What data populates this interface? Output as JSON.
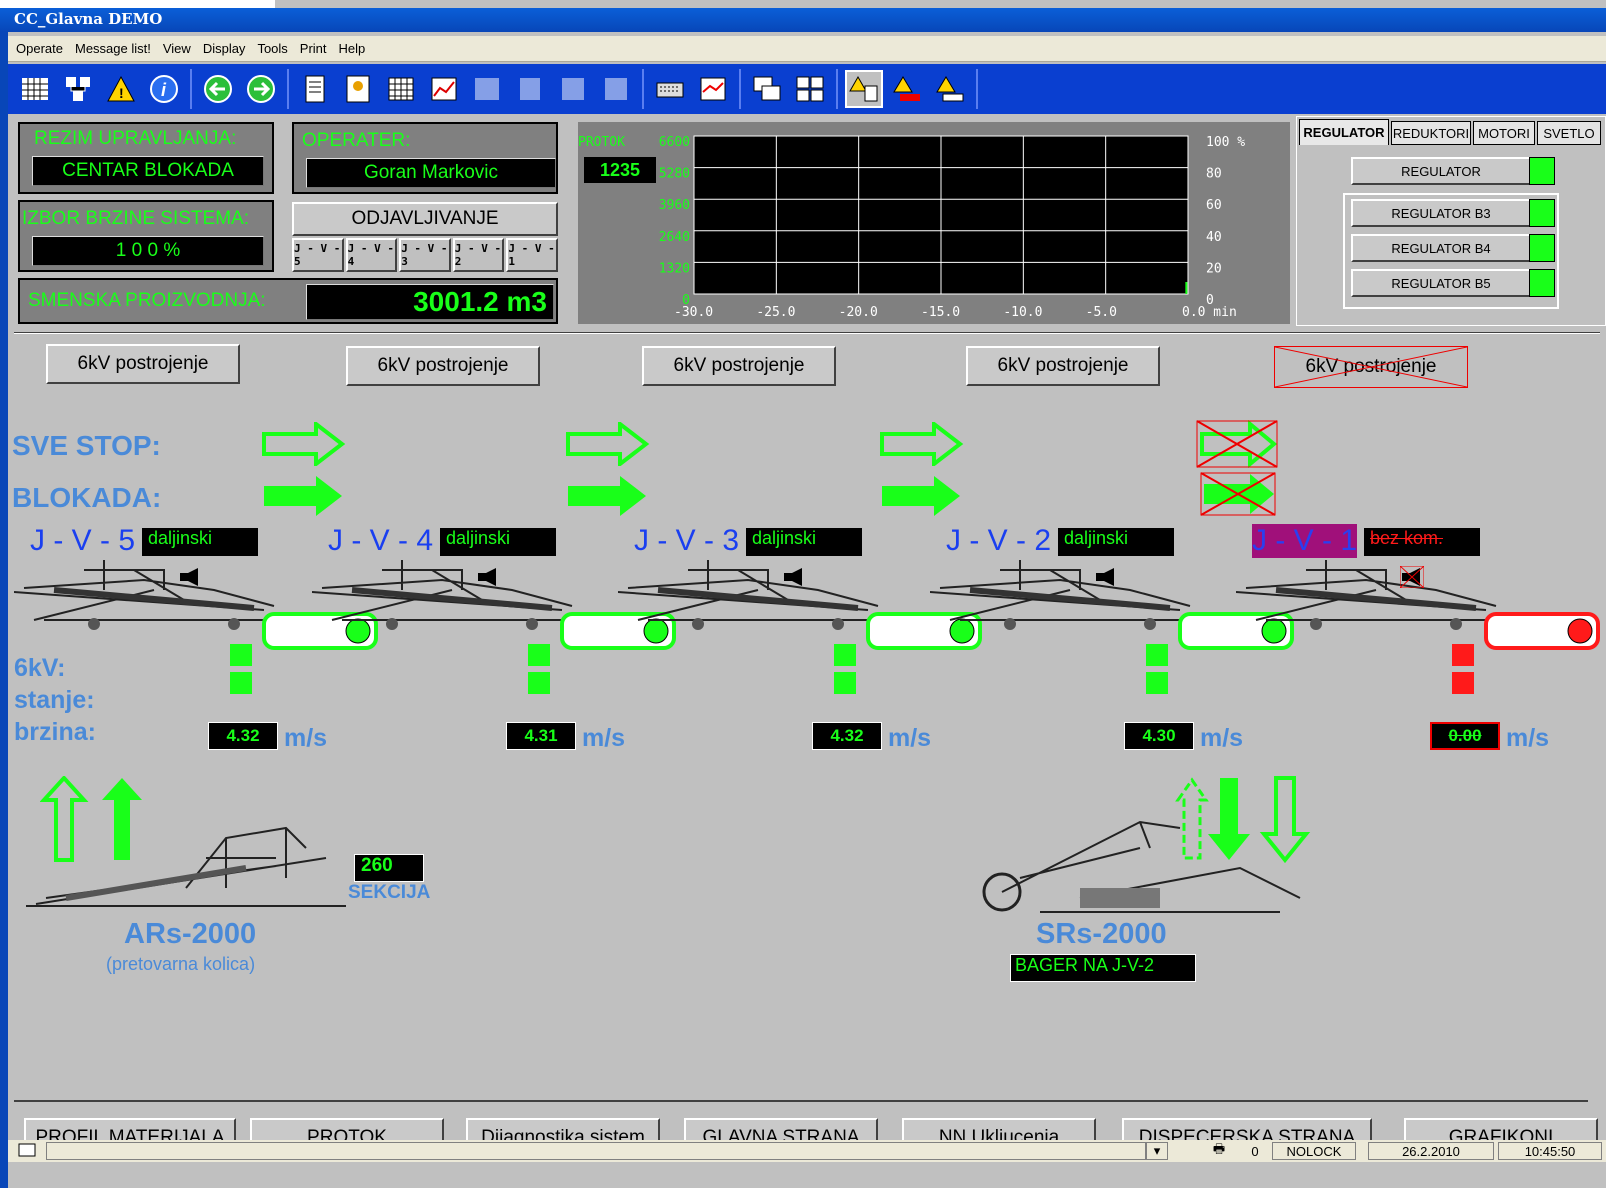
{
  "window": {
    "title": "CC_Glavna DEMO"
  },
  "menu": [
    "Operate",
    "Message list!",
    "View",
    "Display",
    "Tools",
    "Print",
    "Help"
  ],
  "toolbar_icons": [
    "grid-icon",
    "network-icon",
    "warning-icon",
    "info-icon",
    "back-icon",
    "forward-icon",
    "doc-icon",
    "user-icon",
    "table-icon",
    "chart-icon",
    "edit-icon",
    "flow-icon",
    "photo-icon",
    "config-icon",
    "keyboard-icon",
    "chart-add-icon",
    "windows-icon",
    "tile-icon",
    "alarm-list-icon",
    "alarm-red-icon",
    "alarm-ack-icon"
  ],
  "rezim": {
    "label": "REZIM UPRAVLJANJA:",
    "value": "CENTAR BLOKADA"
  },
  "operater": {
    "label": "OPERATER:",
    "value": "Goran Markovic"
  },
  "brzina": {
    "label": "IZBOR BRZINE SISTEMA:",
    "value": "1 0 0 %"
  },
  "odjava": "ODJAVLJIVANJE",
  "jv_buttons": [
    "J - V - 5",
    "J - V - 4",
    "J - V - 3",
    "J - V - 2",
    "J - V - 1"
  ],
  "smenska": {
    "label": "SMENSKA PROIZVODNJA:",
    "value": "3001.2  m3"
  },
  "chart_data": {
    "type": "line",
    "title": "PROTOK",
    "current": "1235",
    "y_left_ticks": [
      "6600",
      "5280",
      "3960",
      "2640",
      "1320",
      "0"
    ],
    "y_right_ticks": [
      "100 %",
      "80",
      "60",
      "40",
      "20",
      "0"
    ],
    "x_ticks": [
      "-30.0",
      "-25.0",
      "-20.0",
      "-15.0",
      "-10.0",
      "-5.0",
      "0.0 min"
    ],
    "xlim": [
      -30,
      0
    ],
    "ylim": [
      0,
      6600
    ],
    "grid": true,
    "series": [
      {
        "x": [
          -0.1
        ],
        "y": [
          0
        ]
      }
    ]
  },
  "tabs": [
    "REGULATOR",
    "REDUKTORI",
    "MOTORI",
    "SVETLO"
  ],
  "regulators": [
    "REGULATOR",
    "REGULATOR B3",
    "REGULATOR B4",
    "REGULATOR B5"
  ],
  "postrojenje": [
    "6kV postrojenje",
    "6kV postrojenje",
    "6kV postrojenje",
    "6kV postrojenje",
    "6kV postrojenje"
  ],
  "labels": {
    "sve_stop": "SVE STOP:",
    "blokada": "BLOKADA:",
    "kv": "6kV:",
    "stanje": "stanje:",
    "brzina": "brzina:",
    "ms": "m/s"
  },
  "conveyors": [
    {
      "name": "J - V - 5",
      "mode": "daljinski",
      "speed": "4.32",
      "state": "ok"
    },
    {
      "name": "J - V - 4",
      "mode": "daljinski",
      "speed": "4.31",
      "state": "ok"
    },
    {
      "name": "J - V - 3",
      "mode": "daljinski",
      "speed": "4.32",
      "state": "ok"
    },
    {
      "name": "J - V - 2",
      "mode": "daljinski",
      "speed": "4.30",
      "state": "ok"
    },
    {
      "name": "J - V - 1",
      "mode": "bez kom.",
      "speed": "0.00",
      "state": "fault"
    }
  ],
  "ars": {
    "title": "ARs-2000",
    "subtitle": "(pretovarna kolica)",
    "sekcija": "260",
    "sekcija_label": "SEKCIJA"
  },
  "srs": {
    "title": "SRs-2000",
    "status": "BAGER NA  J-V-2"
  },
  "bottom_buttons": [
    "PROFIL MATERIJALA",
    "PROTOK",
    "Dijagnostika sistem",
    "GLAVNA STRANA",
    "NN Ukljucenja",
    "DISPECERSKA STRANA",
    "GRAFIKONI"
  ],
  "status": {
    "count": "0",
    "nolock": "NOLOCK",
    "date": "26.2.2010",
    "time": "10:45:50"
  },
  "colors": {
    "green": "#19ff19",
    "red": "#ff1a1a",
    "blue": "#4a8ad8",
    "magenta": "#a0107a"
  }
}
